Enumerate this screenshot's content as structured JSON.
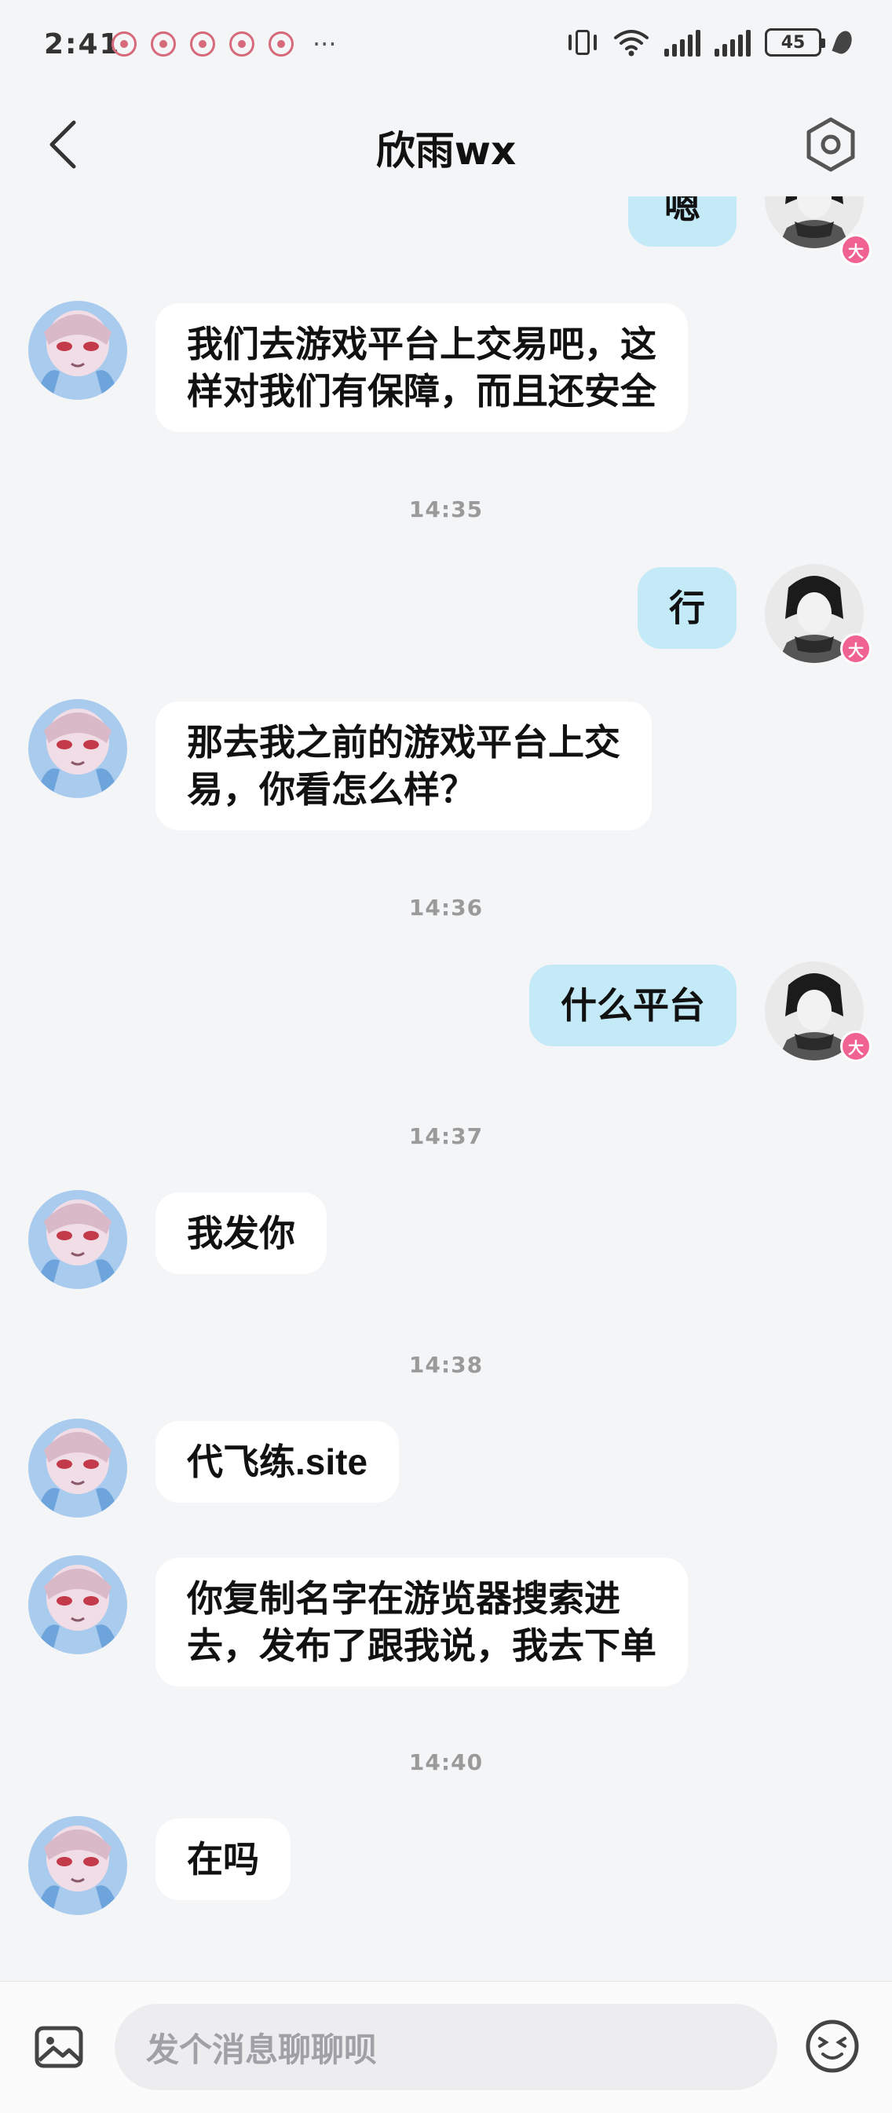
{
  "status_bar": {
    "time": "2:41",
    "notification_count": 5,
    "more": "···",
    "battery": "45"
  },
  "nav": {
    "title": "欣雨wx"
  },
  "colors": {
    "page_bg": "#f4f5f7",
    "my_bubble": "#c4eaf7",
    "other_bubble": "#ffffff",
    "vip_badge": "#f06292"
  },
  "messages": [
    {
      "sender": "me",
      "text": "嗯",
      "partial": true
    },
    {
      "sender": "other",
      "text_lines": [
        "我们去游戏平台上交易吧，这",
        "样对我们有保障，而且还安全"
      ]
    },
    {
      "timestamp": "14:35"
    },
    {
      "sender": "me",
      "text": "行"
    },
    {
      "sender": "other",
      "text_lines": [
        "那去我之前的游戏平台上交",
        "易，你看怎么样？"
      ]
    },
    {
      "timestamp": "14:36"
    },
    {
      "sender": "me",
      "text": "什么平台"
    },
    {
      "timestamp": "14:37"
    },
    {
      "sender": "other",
      "text": "我发你"
    },
    {
      "timestamp": "14:38"
    },
    {
      "sender": "other",
      "text": "代飞练.site"
    },
    {
      "sender": "other",
      "text_lines": [
        "你复制名字在游览器搜索进",
        "去，发布了跟我说，我去下单"
      ]
    },
    {
      "timestamp": "14:40"
    },
    {
      "sender": "other",
      "text": "在吗"
    }
  ],
  "vip_badge_label": "大",
  "input": {
    "placeholder": "发个消息聊聊呗"
  },
  "icons": {
    "back": "chevron-left-icon",
    "settings": "hexagon-settings-icon",
    "image": "image-icon",
    "emoji": "emoji-icon"
  }
}
